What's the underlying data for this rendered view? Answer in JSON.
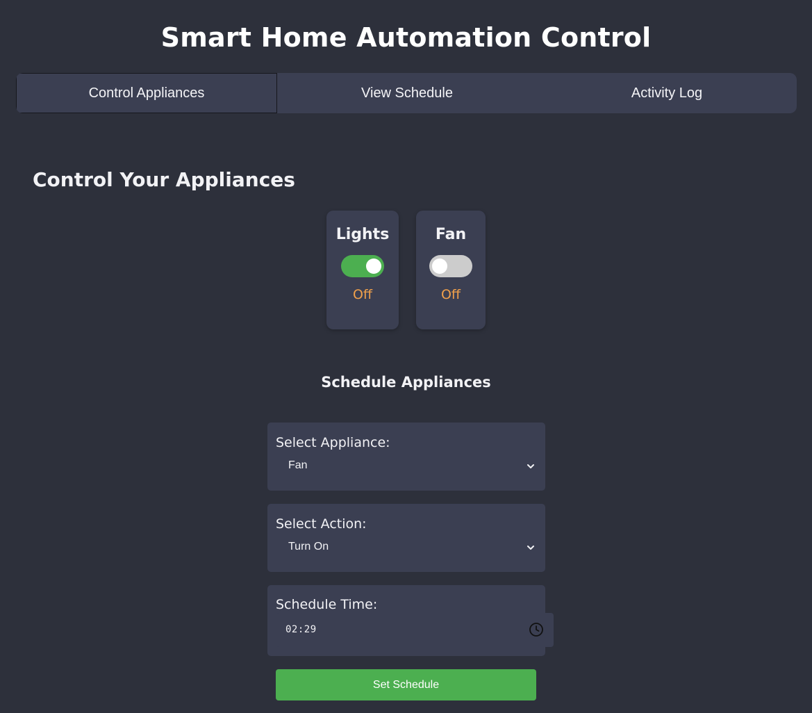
{
  "app": {
    "title": "Smart Home Automation Control"
  },
  "tabs": [
    {
      "label": "Control Appliances",
      "active": true
    },
    {
      "label": "View Schedule",
      "active": false
    },
    {
      "label": "Activity Log",
      "active": false
    }
  ],
  "control": {
    "title": "Control Your Appliances",
    "appliances": [
      {
        "name": "Lights",
        "toggle_on": true,
        "status": "Off"
      },
      {
        "name": "Fan",
        "toggle_on": false,
        "status": "Off"
      }
    ]
  },
  "schedule": {
    "title": "Schedule Appliances",
    "appliance_label": "Select Appliance:",
    "appliance_value": "Fan",
    "action_label": "Select Action:",
    "action_value": "Turn On",
    "time_label": "Schedule Time:",
    "time_value": "02:29",
    "button_label": "Set Schedule"
  },
  "colors": {
    "background": "#2d303b",
    "panel": "#3b3f52",
    "accent_green": "#4caf50",
    "status_orange": "#f0a04b",
    "toggle_off": "#cccccc"
  },
  "icons": {
    "select_arrow": "chevron-down-icon",
    "time_picker": "clock-icon"
  }
}
